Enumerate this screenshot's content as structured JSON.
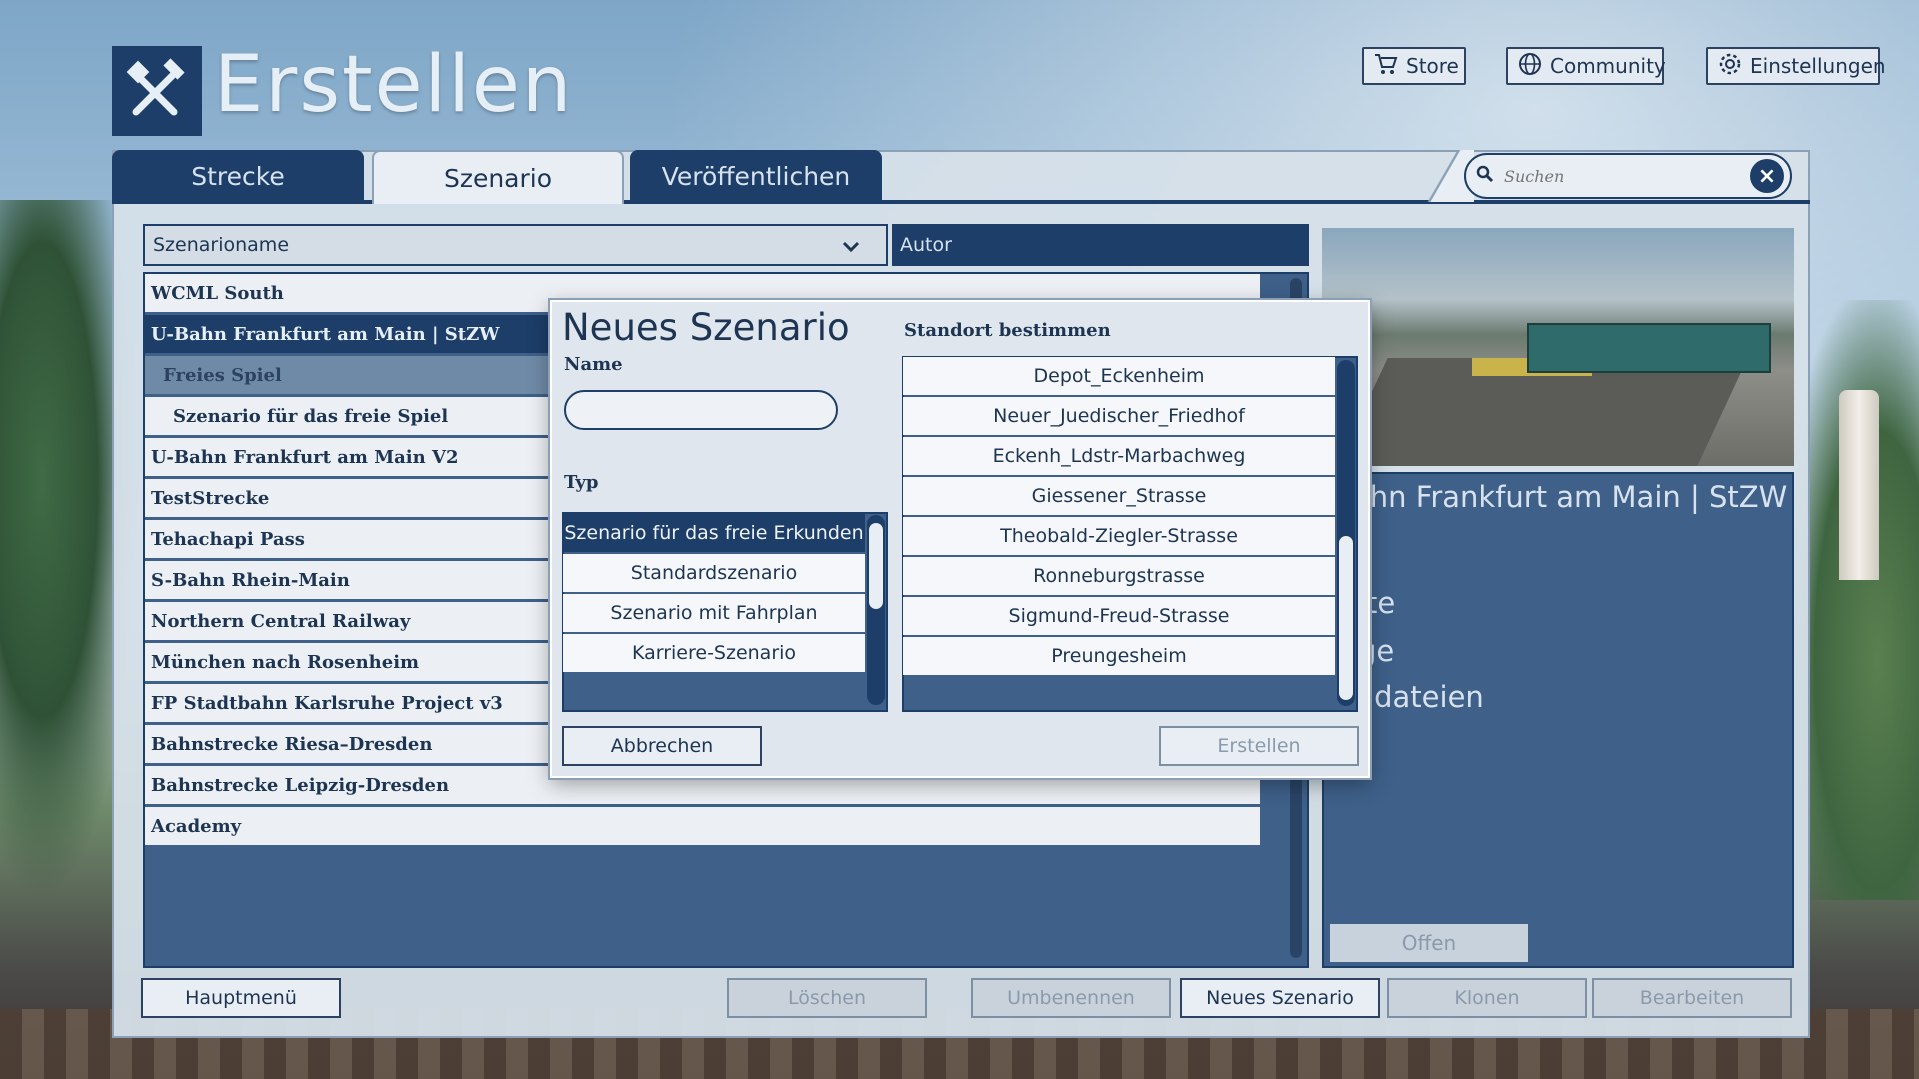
{
  "app": {
    "title": "Erstellen"
  },
  "header_buttons": [
    {
      "label": "Store",
      "icon": "cart-icon"
    },
    {
      "label": "Community",
      "icon": "globe-icon"
    },
    {
      "label": "Einstellungen",
      "icon": "gear-icon"
    }
  ],
  "tabs": [
    {
      "label": "Strecke",
      "active": false
    },
    {
      "label": "Szenario",
      "active": true
    },
    {
      "label": "Veröffentlichen",
      "active": false
    }
  ],
  "search": {
    "placeholder": "Suchen",
    "value": ""
  },
  "columns": {
    "name": "Szenarioname",
    "author": "Autor"
  },
  "list": [
    {
      "label": "WCML South",
      "style": "white"
    },
    {
      "label": "U-Bahn Frankfurt am Main | StZW",
      "style": "selected"
    },
    {
      "label": "Freies Spiel",
      "style": "sub"
    },
    {
      "label": "Szenario für das freie Spiel",
      "style": "child"
    },
    {
      "label": "U-Bahn Frankfurt am Main V2",
      "style": "white"
    },
    {
      "label": "TestStrecke",
      "style": "white"
    },
    {
      "label": "Tehachapi Pass",
      "style": "white"
    },
    {
      "label": "S-Bahn Rhein-Main",
      "style": "white"
    },
    {
      "label": "Northern Central Railway",
      "style": "white"
    },
    {
      "label": "München nach Rosenheim",
      "style": "white"
    },
    {
      "label": "FP Stadtbahn Karlsruhe Project v3",
      "style": "white"
    },
    {
      "label": "Bahnstrecke Riesa–Dresden",
      "style": "white"
    },
    {
      "label": "Bahnstrecke Leipzig-Dresden",
      "style": "white"
    },
    {
      "label": "Academy",
      "style": "white"
    }
  ],
  "info": {
    "title": "ahn Frankfurt am Main | StZW",
    "lines": [
      "ite",
      "ge",
      "lldateien"
    ],
    "open_label": "Offen"
  },
  "bottom_buttons": [
    {
      "label": "Hauptmenü",
      "enabled": true
    },
    {
      "label": "Löschen",
      "enabled": false
    },
    {
      "label": "Umbenennen",
      "enabled": false
    },
    {
      "label": "Neues Szenario",
      "enabled": true
    },
    {
      "label": "Klonen",
      "enabled": false
    },
    {
      "label": "Bearbeiten",
      "enabled": false
    }
  ],
  "dialog": {
    "title": "Neues Szenario",
    "name_label": "Name",
    "name_value": "",
    "type_label": "Typ",
    "types": [
      {
        "label": "Szenario für das freie Erkunden",
        "selected": true
      },
      {
        "label": "Standardszenario",
        "selected": false
      },
      {
        "label": "Szenario mit Fahrplan",
        "selected": false
      },
      {
        "label": "Karriere-Szenario",
        "selected": false
      }
    ],
    "location_label": "Standort bestimmen",
    "locations": [
      "Depot_Eckenheim",
      "Neuer_Juedischer_Friedhof",
      "Eckenh_Ldstr-Marbachweg",
      "Giessener_Strasse",
      "Theobald-Ziegler-Strasse",
      "Ronneburgstrasse",
      "Sigmund-Freud-Strasse",
      "Preungesheim"
    ],
    "cancel_label": "Abbrechen",
    "create_label": "Erstellen"
  },
  "colors": {
    "primary": "#1d3e68",
    "panel": "#3e6089",
    "light": "#e8eef4"
  }
}
